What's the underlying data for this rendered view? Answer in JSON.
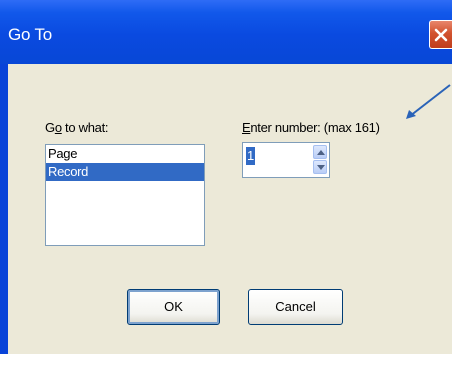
{
  "dialog": {
    "title": "Go To",
    "go_to_label": "Go to what:",
    "list_items": [
      "Page",
      "Record"
    ],
    "selected_item": "Record",
    "enter_number_label": "Enter number: (max 161)",
    "number_value": "1",
    "ok_label": "OK",
    "cancel_label": "Cancel"
  },
  "colors": {
    "titlebar": "#0a4ae0",
    "client_background": "#ece9d8",
    "selection": "#316ac5",
    "close_button": "#d2532f",
    "annotation_arrow": "#2a63b8"
  },
  "icons": {
    "close": "close-icon",
    "spin_up": "chevron-up-icon",
    "spin_down": "chevron-down-icon",
    "annotation": "arrow-icon"
  }
}
